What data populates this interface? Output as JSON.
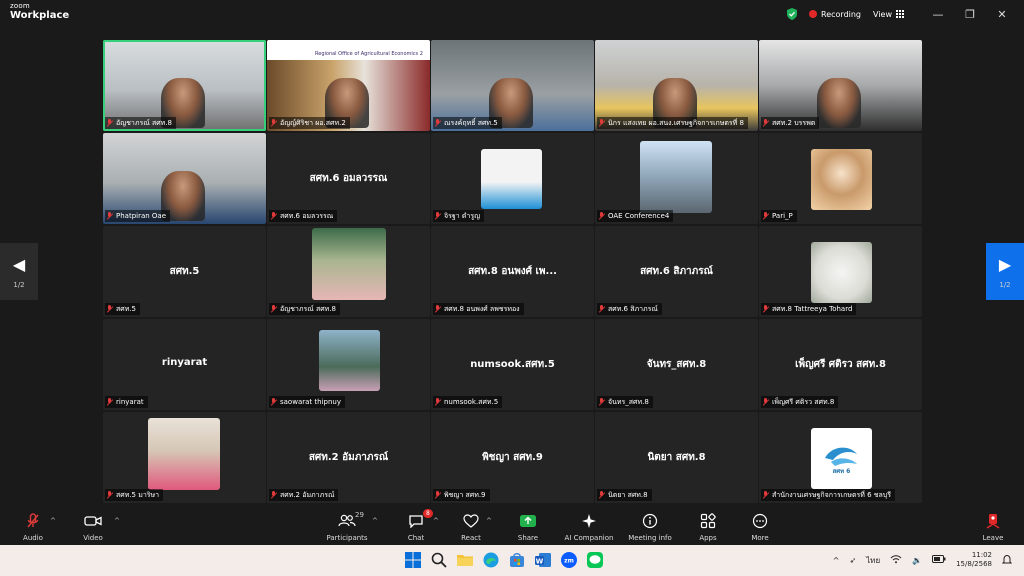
{
  "app": {
    "brand_line1": "zoom",
    "brand_line2": "Workplace"
  },
  "titlebar": {
    "recording_label": "Recording",
    "view_label": "View",
    "min_symbol": "—",
    "max_symbol": "❐",
    "close_symbol": "✕"
  },
  "gallery": {
    "page_indicator_left": "1/2",
    "page_indicator_right": "1/2",
    "tiles": [
      {
        "label": "อัญชาภรณ์ สศท.8",
        "name": "",
        "kind": "video"
      },
      {
        "label": "อัญญ์ศิริชา ผอ.สศท.2",
        "name": "",
        "kind": "video"
      },
      {
        "label": "ณรงค์ฤทธิ์ สศท.5",
        "name": "",
        "kind": "video"
      },
      {
        "label": "นิกร แสงเทย ผอ.สนง.เศรษฐกิจการเกษตรที่ 8",
        "name": "",
        "kind": "video"
      },
      {
        "label": "สศท.2 บรรพต",
        "name": "",
        "kind": "video"
      },
      {
        "label": "Phatpiran Oae",
        "name": "",
        "kind": "video"
      },
      {
        "label": "สศท.6 อมลวรรณ",
        "name": "สศท.6 อมลวรรณ",
        "kind": "text"
      },
      {
        "label": "จิรฐา ดำรูญ",
        "name": "",
        "kind": "avatar"
      },
      {
        "label": "OAE Conference4",
        "name": "",
        "kind": "avatar"
      },
      {
        "label": "Pari_P",
        "name": "",
        "kind": "avatar"
      },
      {
        "label": "สศท.5",
        "name": "สศท.5",
        "kind": "text"
      },
      {
        "label": "อัญชาภรณ์ สศท.8",
        "name": "",
        "kind": "avatar"
      },
      {
        "label": "สศท.8 อนพงศ์ ลพชรทอง",
        "name": "สศท.8 อนพงศ์ เพ...",
        "kind": "text"
      },
      {
        "label": "สศท.6 สิภาภรณ์",
        "name": "สศท.6 สิภาภรณ์",
        "kind": "text"
      },
      {
        "label": "สศท.8 Tattreeya Tohard",
        "name": "",
        "kind": "avatar"
      },
      {
        "label": "rinyarat",
        "name": "rinyarat",
        "kind": "text"
      },
      {
        "label": "saowarat thipnuy",
        "name": "",
        "kind": "avatar"
      },
      {
        "label": "numsook.สศท.5",
        "name": "numsook.สศท.5",
        "kind": "text"
      },
      {
        "label": "จันทร_สศท.8",
        "name": "จันทร_สศท.8",
        "kind": "text"
      },
      {
        "label": "เพ็ญศรี ศติรว สศท.8",
        "name": "เพ็ญศรี ศติรว สศท.8",
        "kind": "text"
      },
      {
        "label": "สศท.5 มาริษา",
        "name": "",
        "kind": "avatar"
      },
      {
        "label": "สศท.2 อัมภาภรณ์",
        "name": "สศท.2 อัมภาภรณ์",
        "kind": "text"
      },
      {
        "label": "พิชญา สศท.9",
        "name": "พิชญา สศท.9",
        "kind": "text"
      },
      {
        "label": "นิตยา สศท.8",
        "name": "นิตยา สศท.8",
        "kind": "text"
      },
      {
        "label": "สำนักงานเศรษฐกิจการเกษตรที่ 6 ชลบุรี",
        "name": "",
        "kind": "avatar"
      }
    ],
    "tile2_banner": "Regional Office of Agricultural Economics 2",
    "logo_text": "สศท 6"
  },
  "toolbar": {
    "audio": "Audio",
    "video": "Video",
    "participants": "Participants",
    "participants_count": "29",
    "chat": "Chat",
    "chat_badge": "8",
    "react": "React",
    "share": "Share",
    "ai_companion": "AI Companion",
    "meeting_info": "Meeting info",
    "apps": "Apps",
    "more": "More",
    "leave": "Leave"
  },
  "taskbar": {
    "language": "ไทย",
    "time": "11:02",
    "date": "15/8/2568"
  },
  "colors": {
    "active_speaker": "#36d07a",
    "recording": "#e02828",
    "accent": "#0e71eb"
  }
}
